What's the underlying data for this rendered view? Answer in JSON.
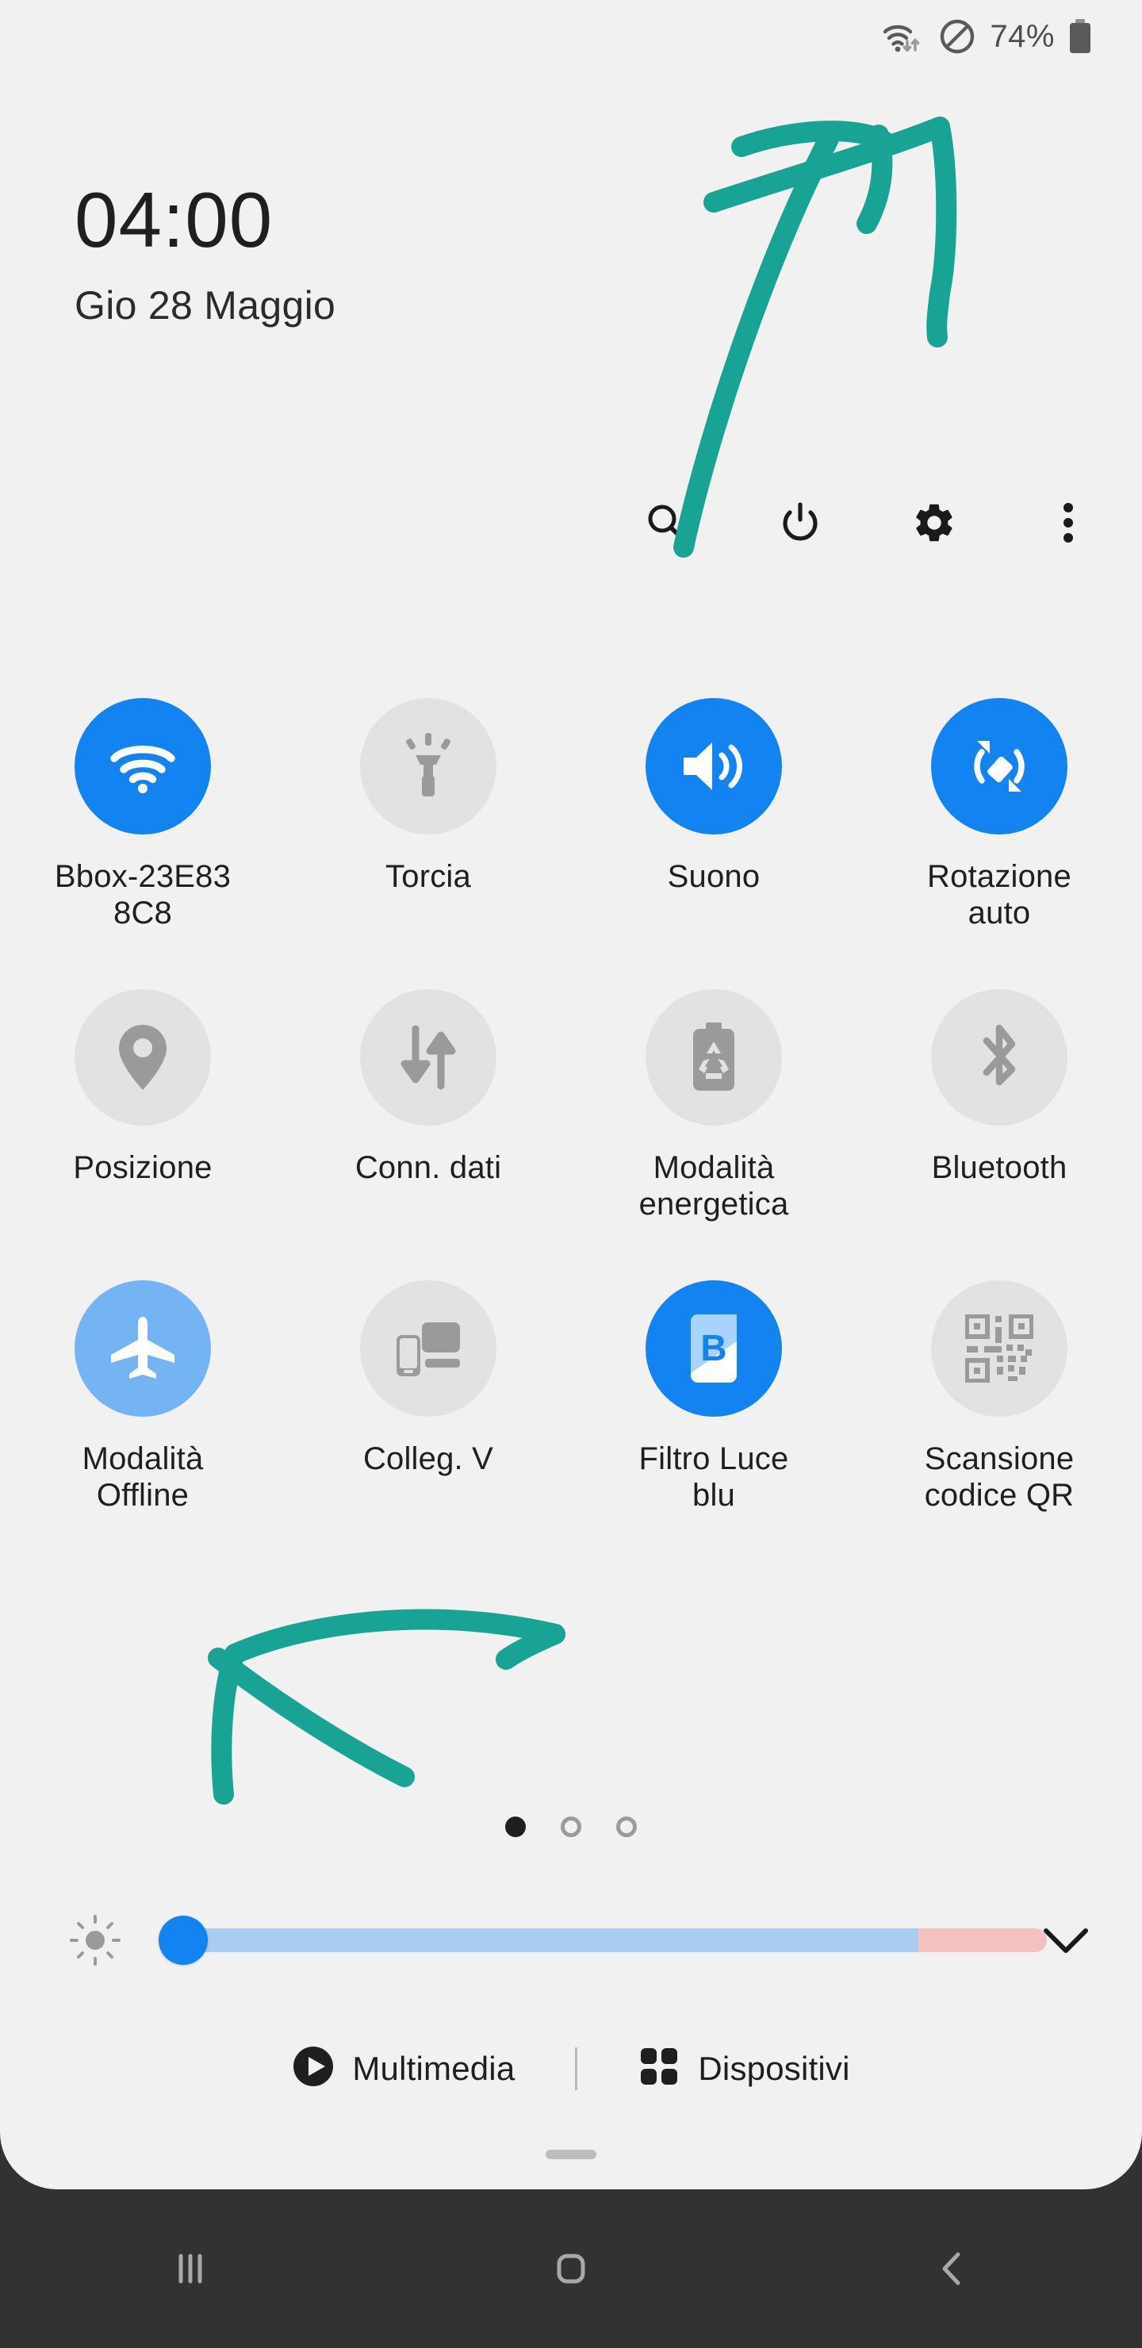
{
  "status_bar": {
    "battery_percent": "74%",
    "icons": [
      "wifi-data-icon",
      "do-not-disturb-icon",
      "battery-icon"
    ]
  },
  "header": {
    "time": "04:00",
    "date": "Gio 28 Maggio",
    "actions": [
      {
        "name": "search-icon",
        "label": "Cerca"
      },
      {
        "name": "power-icon",
        "label": "Spegni"
      },
      {
        "name": "gear-icon",
        "label": "Impostazioni"
      },
      {
        "name": "overflow-menu-icon",
        "label": "Altro"
      }
    ]
  },
  "tiles": [
    {
      "label": "Bbox-23E83 8C8",
      "icon": "wifi-icon",
      "state": "on"
    },
    {
      "label": "Torcia",
      "icon": "flashlight-icon",
      "state": "off"
    },
    {
      "label": "Suono",
      "icon": "volume-icon",
      "state": "on"
    },
    {
      "label": "Rotazione auto",
      "icon": "auto-rotate-icon",
      "state": "on"
    },
    {
      "label": "Posizione",
      "icon": "location-pin-icon",
      "state": "off"
    },
    {
      "label": "Conn. dati",
      "icon": "mobile-data-icon",
      "state": "off"
    },
    {
      "label": "Modalità energetica",
      "icon": "power-saving-icon",
      "state": "off"
    },
    {
      "label": "Bluetooth",
      "icon": "bluetooth-icon",
      "state": "off"
    },
    {
      "label": "Modalità Offline",
      "icon": "airplane-icon",
      "state": "soft"
    },
    {
      "label": "Colleg. V",
      "icon": "nearby-share-icon",
      "state": "off"
    },
    {
      "label": "Filtro Luce blu",
      "icon": "blue-light-filter-icon",
      "state": "on"
    },
    {
      "label": "Scansione codice QR",
      "icon": "qr-code-icon",
      "state": "off"
    }
  ],
  "pager": {
    "total_pages": 3,
    "active_page": 1
  },
  "brightness": {
    "icon": "brightness-icon",
    "value_percent": 4,
    "expand_icon": "chevron-down-icon"
  },
  "bottom_bar": {
    "media_label": "Multimedia",
    "media_icon": "play-circle-icon",
    "devices_label": "Dispositivi",
    "devices_icon": "grid-dots-icon"
  },
  "nav_bar": {
    "recents_icon": "recents-icon",
    "home_icon": "home-icon",
    "back_icon": "back-icon"
  },
  "annotations": {
    "color": "#18a394",
    "marks": [
      {
        "name": "arrow-to-search-icon",
        "type": "hand-drawn-arrow"
      },
      {
        "name": "arrow-to-nearby-share-tile",
        "type": "hand-drawn-arrow"
      }
    ]
  },
  "colors": {
    "accent_on": "#1283f0",
    "accent_soft": "#74b4f2",
    "tile_off": "#e2e2e2",
    "panel_bg": "#f1f1f1",
    "navbar_bg": "#323232",
    "annotation": "#18a394"
  }
}
